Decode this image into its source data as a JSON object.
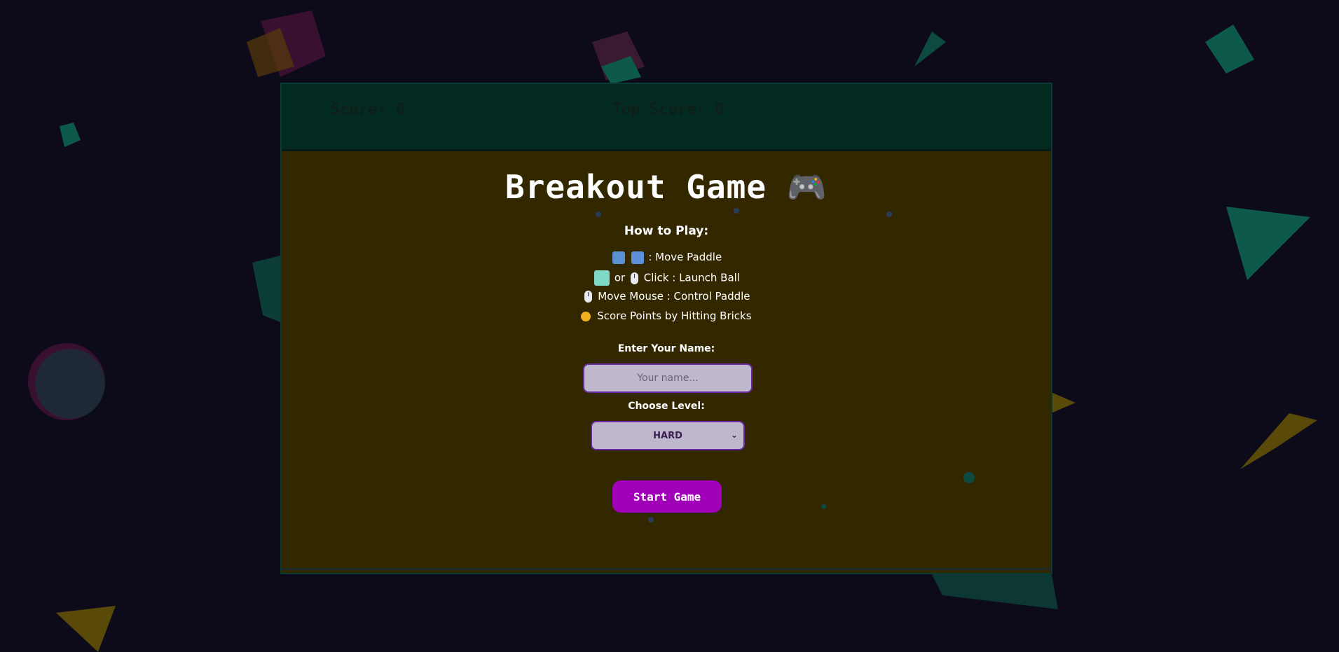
{
  "scoreboard": {
    "score_label": "Score: 0",
    "top_score_label": "Top Score: 0"
  },
  "title": "Breakout Game 🎮",
  "how_to_play": {
    "heading": "How to Play:",
    "lines": [
      ": Move Paddle",
      "or",
      "Click : Launch Ball",
      "Move Mouse : Control Paddle",
      "Score Points by Hitting Bricks"
    ]
  },
  "name_field": {
    "label": "Enter Your Name:",
    "placeholder": "Your name...",
    "value": ""
  },
  "level_field": {
    "label": "Choose Level:",
    "selected": "HARD"
  },
  "start_button": {
    "label": "Start Game"
  },
  "colors": {
    "background": "#0d0a1a",
    "game_area": "#332700",
    "score_bar": "#032b22",
    "accent": "#a000b8"
  },
  "icons": [
    "left-arrow-key-icon",
    "right-arrow-key-icon",
    "space-key-icon",
    "mouse-icon",
    "medal-icon",
    "gamepad-icon"
  ]
}
